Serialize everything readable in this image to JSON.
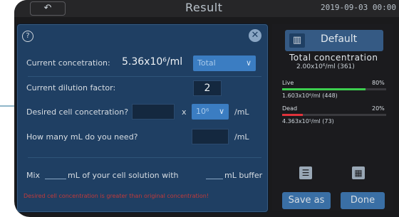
{
  "topbar": {
    "back_label": "↶",
    "title": "Result",
    "datetime": "2019-09-03 00:00"
  },
  "dialog": {
    "help_label": "?",
    "close_label": "✕",
    "current_conc_label": "Current concetration:",
    "current_conc_value": "5.36x10⁶/ml",
    "conc_type": "Total",
    "dilution_label": "Current dilution factor:",
    "dilution_value": "2",
    "desired_label": "Desired cell concetration?",
    "desired_value": "",
    "desired_multiplier": "x",
    "desired_exponent": "10⁶",
    "desired_unit": "/mL",
    "need_label": "How many mL do you need?",
    "need_value": "",
    "need_unit": "/mL",
    "mix_word": "Mix",
    "mix_middle": "mL of your cell solution with",
    "mix_end": "mL buffer",
    "warning": "Desired cell concentration is greater than original concentration!"
  },
  "side": {
    "default_label": "Default",
    "total_title": "Total concentration",
    "total_value": "2.00x10⁶/ml (361)",
    "live": {
      "label": "Live",
      "percent": "80%",
      "detail": "1.603x10⁶/ml  (448)",
      "color": "#3ccf4e",
      "fill": 0.8
    },
    "dead": {
      "label": "Dead",
      "percent": "20%",
      "detail": "4.363x10⁵/ml  (73)",
      "color": "#e0323b",
      "fill": 0.2
    },
    "save_label": "Save as",
    "done_label": "Done"
  },
  "colors": {
    "accent": "#3b7dc2",
    "dialog_bg": "#1f3f63",
    "warning": "#c23a3a"
  }
}
